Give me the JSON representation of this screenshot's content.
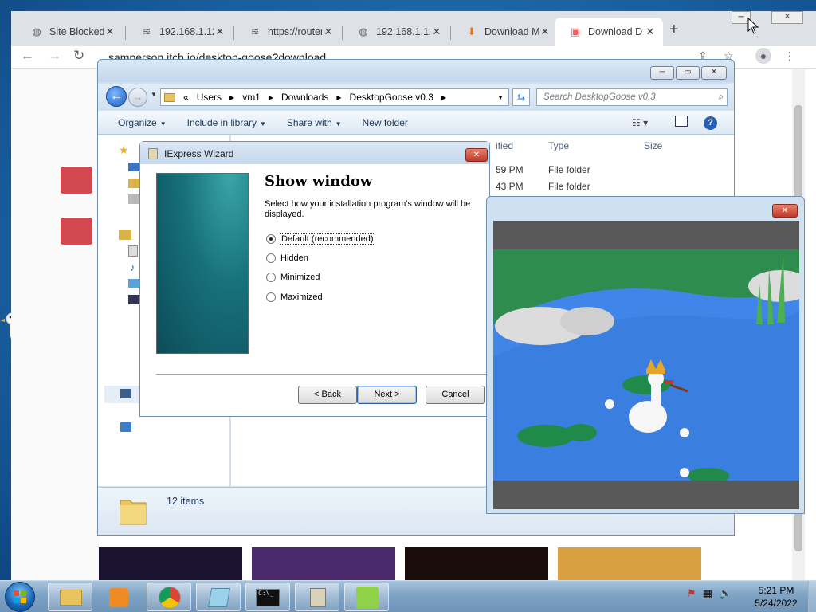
{
  "browser": {
    "tabs": [
      {
        "label": "Site Blocked",
        "icon": "globe-icon"
      },
      {
        "label": "192.168.1.12",
        "icon": "wifi-icon"
      },
      {
        "label": "https://router",
        "icon": "wifi-icon"
      },
      {
        "label": "192.168.1.12",
        "icon": "globe-icon"
      },
      {
        "label": "Download M",
        "icon": "download-icon"
      },
      {
        "label": "Download D",
        "icon": "itch-icon"
      }
    ],
    "url": "samperson.itch.io/desktop-goose?download",
    "new_tab": "+"
  },
  "explorer": {
    "breadcrumb": [
      "«",
      "Users",
      "vm1",
      "Downloads",
      "DesktopGoose v0.3"
    ],
    "search_placeholder": "Search DesktopGoose v0.3",
    "commands": [
      "Organize",
      "Include in library",
      "Share with",
      "New folder"
    ],
    "columns": [
      "ified",
      "Type",
      "Size"
    ],
    "rows": [
      {
        "modified": "59 PM",
        "type": "File folder"
      },
      {
        "modified": "43 PM",
        "type": "File folder"
      }
    ],
    "status": "12 items"
  },
  "wizard": {
    "title": "IExpress Wizard",
    "heading": "Show window",
    "description": "Select how your installation program's window will be displayed.",
    "options": [
      "Default (recommended)",
      "Hidden",
      "Minimized",
      "Maximized"
    ],
    "selected": 0,
    "buttons": {
      "back": "< Back",
      "next": "Next >",
      "cancel": "Cancel"
    }
  },
  "taskbar": {
    "time": "5:21 PM",
    "date": "5/24/2022"
  },
  "colors": {
    "desktop": "#1f6db0",
    "accent_red": "#d3494f",
    "pond_water": "#3f86e8",
    "grass": "#2e8c4f"
  }
}
